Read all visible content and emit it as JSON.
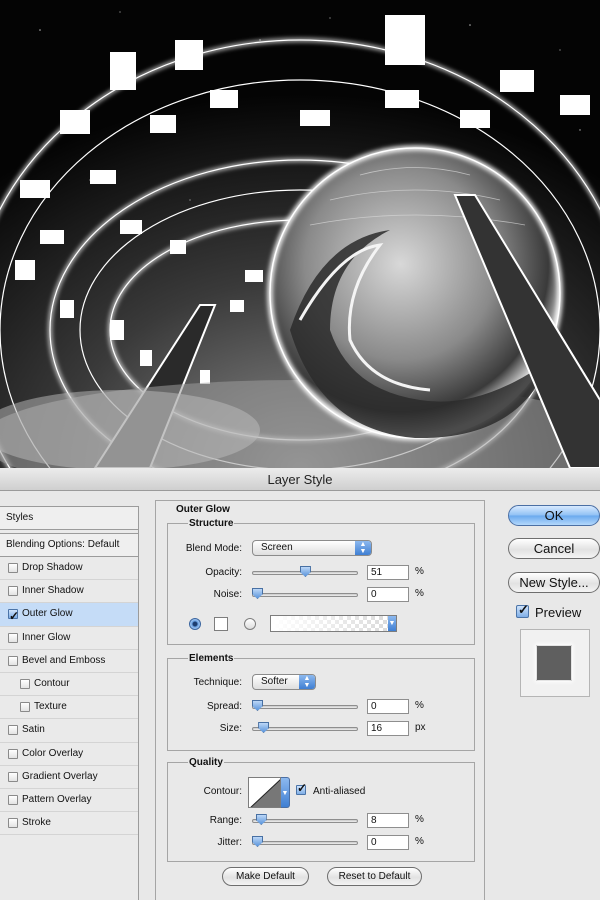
{
  "window": {
    "title": "Layer Style"
  },
  "styles_list": {
    "header": "Styles",
    "blending": "Blending Options: Default",
    "items": [
      {
        "label": "Drop Shadow",
        "checked": false
      },
      {
        "label": "Inner Shadow",
        "checked": false
      },
      {
        "label": "Outer Glow",
        "checked": true
      },
      {
        "label": "Inner Glow",
        "checked": false
      },
      {
        "label": "Bevel and Emboss",
        "checked": false
      },
      {
        "label": "Contour",
        "checked": false
      },
      {
        "label": "Texture",
        "checked": false
      },
      {
        "label": "Satin",
        "checked": false
      },
      {
        "label": "Color Overlay",
        "checked": false
      },
      {
        "label": "Gradient Overlay",
        "checked": false
      },
      {
        "label": "Pattern Overlay",
        "checked": false
      },
      {
        "label": "Stroke",
        "checked": false
      }
    ]
  },
  "panel": {
    "title": "Outer Glow",
    "structure": {
      "title": "Structure",
      "blend_mode_label": "Blend Mode:",
      "blend_mode": "Screen",
      "opacity_label": "Opacity:",
      "opacity": "51",
      "opacity_unit": "%",
      "opacity_level": 0.51,
      "noise_label": "Noise:",
      "noise": "0",
      "noise_unit": "%",
      "noise_level": 0.0
    },
    "elements": {
      "title": "Elements",
      "technique_label": "Technique:",
      "technique": "Softer",
      "spread_label": "Spread:",
      "spread": "0",
      "spread_unit": "%",
      "spread_level": 0.0,
      "size_label": "Size:",
      "size": "16",
      "size_unit": "px",
      "size_level": 0.065
    },
    "quality": {
      "title": "Quality",
      "contour_label": "Contour:",
      "anti_aliased_label": "Anti-aliased",
      "anti_aliased": true,
      "range_label": "Range:",
      "range": "8",
      "range_unit": "%",
      "range_level": 0.04,
      "jitter_label": "Jitter:",
      "jitter": "0",
      "jitter_unit": "%",
      "jitter_level": 0.0
    },
    "make_default": "Make Default",
    "reset_default": "Reset to Default"
  },
  "buttons": {
    "ok": "OK",
    "cancel": "Cancel",
    "new_style": "New Style...",
    "preview_label": "Preview",
    "preview_checked": true
  },
  "colors": {
    "accent": "#6aa9ee",
    "selected_row": "#c5dcf7",
    "dialog_bg": "#e8e8e8"
  },
  "icons": {
    "checkbox": "check-icon",
    "popup": "updown-arrow-icon",
    "slider": "slider-thumb-icon"
  }
}
